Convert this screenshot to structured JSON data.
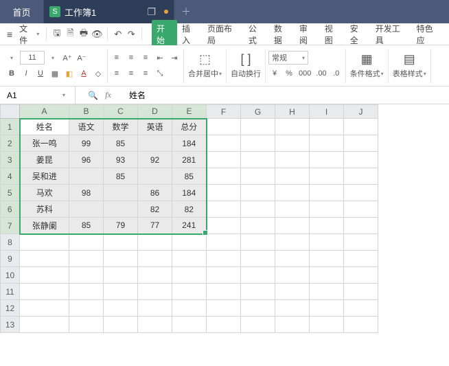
{
  "tabs": {
    "home": "首页",
    "workbook": "工作簿1",
    "wb_icon": "S"
  },
  "menu": {
    "file": "文件",
    "ribbon_tabs": [
      "开始",
      "插入",
      "页面布局",
      "公式",
      "数据",
      "审阅",
      "视图",
      "安全",
      "开发工具",
      "特色应"
    ],
    "active_tab_index": 0
  },
  "ribbon": {
    "font_size": "11",
    "merge": "合并居中",
    "wrap": "自动换行",
    "number_format": "常规",
    "cond_fmt": "条件格式",
    "table_style": "表格样式",
    "currency": "¥",
    "percent": "%",
    "comma": "000",
    "dec_inc": ".00",
    "dec_dec": ".0"
  },
  "fx": {
    "name_box": "A1",
    "formula": "姓名"
  },
  "grid": {
    "columns": [
      "A",
      "B",
      "C",
      "D",
      "E",
      "F",
      "G",
      "H",
      "I",
      "J"
    ],
    "selected_cols": 5,
    "selected_rows": 7,
    "rows": [
      [
        "姓名",
        "语文",
        "数学",
        "英语",
        "总分",
        "",
        "",
        "",
        "",
        ""
      ],
      [
        "张一鸣",
        "99",
        "85",
        "",
        "184",
        "",
        "",
        "",
        "",
        ""
      ],
      [
        "姜昆",
        "96",
        "93",
        "92",
        "281",
        "",
        "",
        "",
        "",
        ""
      ],
      [
        "吴和进",
        "",
        "85",
        "",
        "85",
        "",
        "",
        "",
        "",
        ""
      ],
      [
        "马欢",
        "98",
        "",
        "86",
        "184",
        "",
        "",
        "",
        "",
        ""
      ],
      [
        "苏科",
        "",
        "",
        "82",
        "82",
        "",
        "",
        "",
        "",
        ""
      ],
      [
        "张静阑",
        "85",
        "79",
        "77",
        "241",
        "",
        "",
        "",
        "",
        ""
      ],
      [
        "",
        "",
        "",
        "",
        "",
        "",
        "",
        "",
        "",
        ""
      ],
      [
        "",
        "",
        "",
        "",
        "",
        "",
        "",
        "",
        "",
        ""
      ],
      [
        "",
        "",
        "",
        "",
        "",
        "",
        "",
        "",
        "",
        ""
      ],
      [
        "",
        "",
        "",
        "",
        "",
        "",
        "",
        "",
        "",
        ""
      ],
      [
        "",
        "",
        "",
        "",
        "",
        "",
        "",
        "",
        "",
        ""
      ],
      [
        "",
        "",
        "",
        "",
        "",
        "",
        "",
        "",
        "",
        ""
      ]
    ]
  }
}
